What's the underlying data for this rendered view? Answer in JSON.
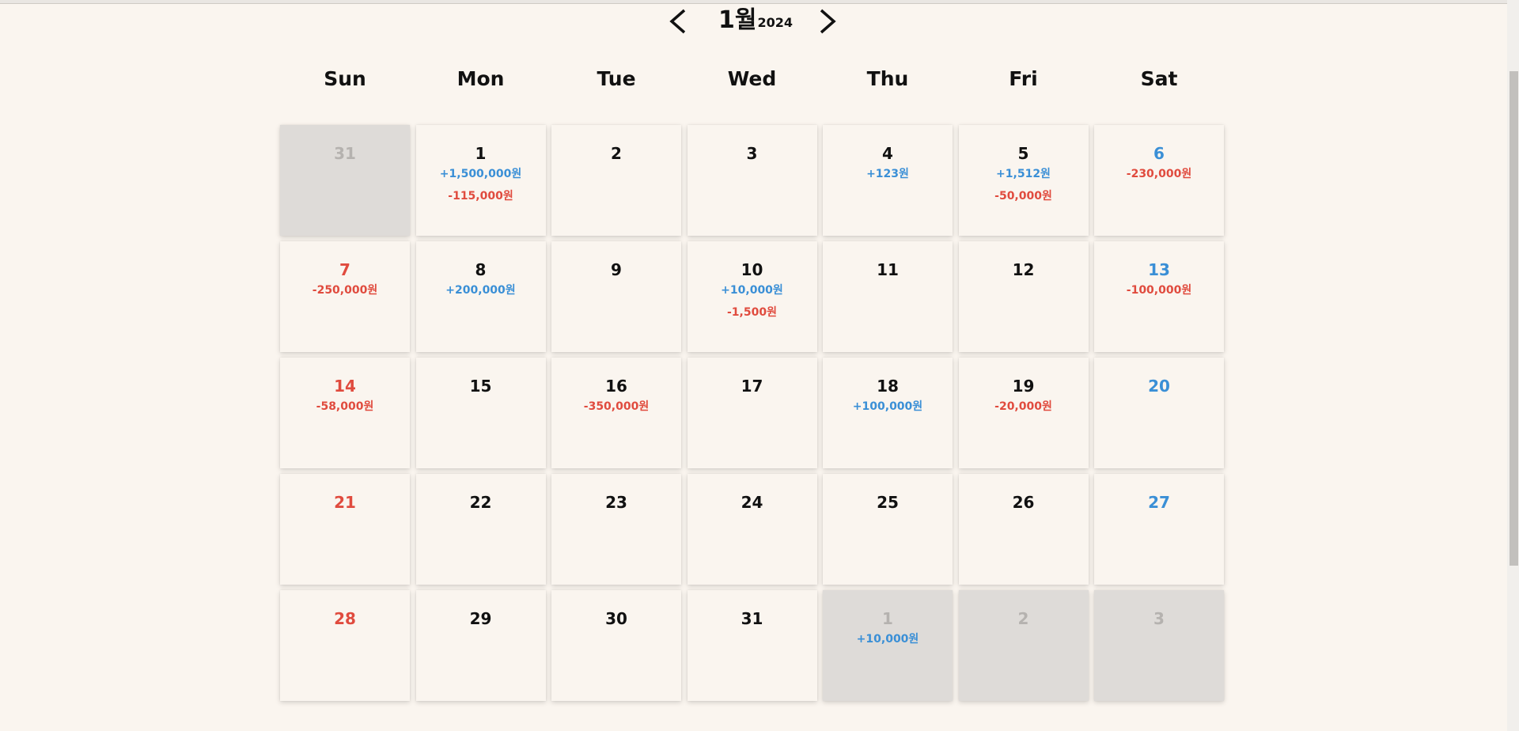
{
  "header": {
    "month": "1월",
    "year": "2024",
    "prev_icon": "chevron-left-icon",
    "next_icon": "chevron-right-icon"
  },
  "weekdays": [
    "Sun",
    "Mon",
    "Tue",
    "Wed",
    "Thu",
    "Fri",
    "Sat"
  ],
  "colors": {
    "background": "#faf5ef",
    "other_month": "#dedbd8",
    "income": "#3a8fd6",
    "expense": "#e04b3e",
    "sunday": "#e04b3e",
    "saturday": "#3a8fd6",
    "holiday": "#26a34d"
  },
  "calendar": {
    "days": [
      {
        "num": "31",
        "other": true,
        "color": "other",
        "amounts": []
      },
      {
        "num": "1",
        "other": false,
        "color": "normal",
        "amounts": [
          {
            "text": "+1,500,000원",
            "type": "inc"
          },
          {
            "text": "-115,000원",
            "type": "exp"
          }
        ]
      },
      {
        "num": "2",
        "other": false,
        "color": "normal",
        "amounts": []
      },
      {
        "num": "3",
        "other": false,
        "color": "normal",
        "amounts": []
      },
      {
        "num": "4",
        "other": false,
        "color": "normal",
        "amounts": [
          {
            "text": "+123원",
            "type": "inc"
          }
        ]
      },
      {
        "num": "5",
        "other": false,
        "color": "normal",
        "amounts": [
          {
            "text": "+1,512원",
            "type": "inc"
          },
          {
            "text": "-50,000원",
            "type": "exp"
          }
        ]
      },
      {
        "num": "6",
        "other": false,
        "color": "sat",
        "amounts": [
          {
            "text": "-230,000원",
            "type": "exp"
          }
        ]
      },
      {
        "num": "7",
        "other": false,
        "color": "sun",
        "amounts": [
          {
            "text": "-250,000원",
            "type": "exp"
          }
        ]
      },
      {
        "num": "8",
        "other": false,
        "color": "normal",
        "amounts": [
          {
            "text": "+200,000원",
            "type": "inc"
          }
        ]
      },
      {
        "num": "9",
        "other": false,
        "color": "normal",
        "amounts": []
      },
      {
        "num": "10",
        "other": false,
        "color": "normal",
        "amounts": [
          {
            "text": "+10,000원",
            "type": "inc"
          },
          {
            "text": "-1,500원",
            "type": "exp"
          }
        ]
      },
      {
        "num": "11",
        "other": false,
        "color": "normal",
        "amounts": []
      },
      {
        "num": "12",
        "other": false,
        "color": "normal",
        "amounts": []
      },
      {
        "num": "13",
        "other": false,
        "color": "sat",
        "amounts": [
          {
            "text": "-100,000원",
            "type": "exp"
          }
        ]
      },
      {
        "num": "14",
        "other": false,
        "color": "sun",
        "amounts": [
          {
            "text": "-58,000원",
            "type": "exp"
          }
        ]
      },
      {
        "num": "15",
        "other": false,
        "color": "normal",
        "amounts": []
      },
      {
        "num": "16",
        "other": false,
        "color": "normal",
        "amounts": [
          {
            "text": "-350,000원",
            "type": "exp"
          }
        ]
      },
      {
        "num": "17",
        "other": false,
        "color": "normal",
        "amounts": []
      },
      {
        "num": "18",
        "other": false,
        "color": "normal",
        "amounts": [
          {
            "text": "+100,000원",
            "type": "inc"
          }
        ]
      },
      {
        "num": "19",
        "other": false,
        "color": "normal",
        "amounts": [
          {
            "text": "-20,000원",
            "type": "exp"
          }
        ]
      },
      {
        "num": "20",
        "other": false,
        "color": "sat",
        "amounts": []
      },
      {
        "num": "21",
        "other": false,
        "color": "sun",
        "amounts": []
      },
      {
        "num": "22",
        "other": false,
        "color": "normal",
        "amounts": []
      },
      {
        "num": "23",
        "other": false,
        "color": "normal",
        "amounts": []
      },
      {
        "num": "24",
        "other": false,
        "color": "normal",
        "amounts": []
      },
      {
        "num": "25",
        "other": false,
        "color": "normal",
        "amounts": []
      },
      {
        "num": "26",
        "other": false,
        "color": "normal",
        "amounts": []
      },
      {
        "num": "27",
        "other": false,
        "color": "sat",
        "amounts": []
      },
      {
        "num": "28",
        "other": false,
        "color": "sun",
        "amounts": []
      },
      {
        "num": "29",
        "other": false,
        "color": "normal",
        "amounts": []
      },
      {
        "num": "30",
        "other": false,
        "color": "normal",
        "amounts": []
      },
      {
        "num": "31",
        "other": false,
        "color": "normal",
        "amounts": []
      },
      {
        "num": "1",
        "other": true,
        "color": "other",
        "amounts": [
          {
            "text": "+10,000원",
            "type": "inc"
          }
        ]
      },
      {
        "num": "2",
        "other": true,
        "color": "other",
        "amounts": []
      },
      {
        "num": "3",
        "other": true,
        "color": "holiday",
        "amounts": []
      }
    ]
  }
}
